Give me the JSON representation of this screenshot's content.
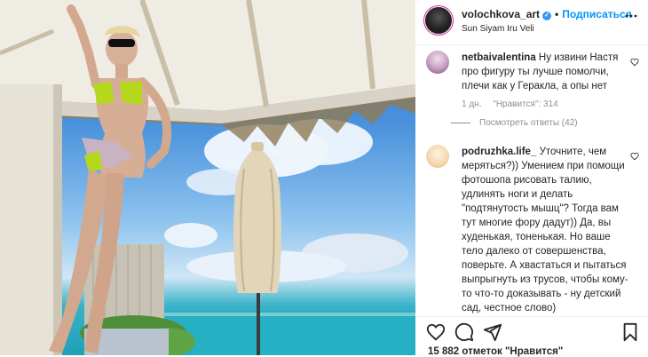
{
  "post": {
    "username": "volochkova_art",
    "verified": true,
    "follow_label": "Подписаться",
    "location": "Sun Siyam Iru Veli"
  },
  "comments": [
    {
      "username": "netbaivalentina",
      "text": "Ну извини Настя про фигуру ты лучше помолчи, плечи как у Геракла, а опы нет",
      "time": "1 дн.",
      "likes": "\"Нравится\": 314",
      "replies": "Посмотреть ответы (42)"
    },
    {
      "username": "podruzhka.life_",
      "text": "Уточните, чем меряться?)) Умением при помощи фотошопа рисовать талию, удлинять ноги и делать \"подтянутость мышц\"? Тогда вам тут многие фору дадут)) Да, вы худенькая, тоненькая. Но ваше тело далеко от совершенства, поверьте. А хвастаться и пытаться выпрыгнуть из трусов, чтобы кому-то что-то доказывать - ну детский сад, честное слово)"
    }
  ],
  "likes_line": "15 882 отметок \"Нравится\"",
  "icons": [
    "close-icon",
    "heart-icon",
    "comment-icon",
    "share-icon",
    "bookmark-icon",
    "verified-badge-icon"
  ],
  "colors": {
    "accent": "#0095f6",
    "verified": "#3897f0",
    "muted": "#8e8e8e"
  }
}
